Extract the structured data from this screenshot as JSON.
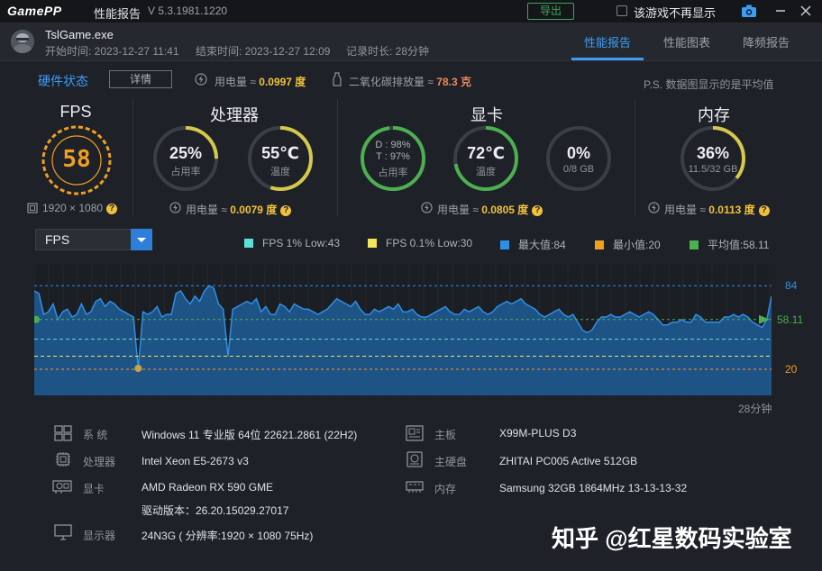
{
  "titlebar": {
    "logo": "GamePP",
    "app_name": "性能报告",
    "version": "V 5.3.1981.1220",
    "export_label": "导出",
    "dont_show_label": "该游戏不再显示"
  },
  "header": {
    "game_name": "TslGame.exe",
    "start_time": "开始时间: 2023-12-27 11:41",
    "end_time": "结束时间: 2023-12-27 12:09",
    "duration": "记录时长: 28分钟",
    "tabs": [
      {
        "label": "性能报告",
        "active": true
      },
      {
        "label": "性能图表",
        "active": false
      },
      {
        "label": "降频报告",
        "active": false
      }
    ]
  },
  "hardware": {
    "title": "硬件状态",
    "detail_label": "详情",
    "power_label": "用电量 ≈",
    "power_value": "0.0997 度",
    "co2_label": "二氧化碳排放量 ≈",
    "co2_value": "78.3 克",
    "ps_note": "P.S. 数据图显示的是平均值",
    "fps": {
      "title": "FPS",
      "value": "58",
      "resolution": "1920 × 1080"
    },
    "cpu": {
      "title": "处理器",
      "usage_value": "25%",
      "usage_label": "占用率",
      "usage_frac": 0.25,
      "temp_value": "55℃",
      "temp_label": "温度",
      "temp_frac": 0.55,
      "power_label": "用电量 ≈",
      "power_value": "0.0079 度"
    },
    "gpu": {
      "title": "显卡",
      "d_value": "D : 98%",
      "t_value": "T : 97%",
      "usage_label": "占用率",
      "usage_frac": 0.98,
      "temp_value": "72℃",
      "temp_label": "温度",
      "temp_frac": 0.72,
      "vram_value": "0%",
      "vram_label": "0/8 GB",
      "vram_frac": 0.0,
      "power_label": "用电量 ≈",
      "power_value": "0.0805 度"
    },
    "memory": {
      "title": "内存",
      "usage_value": "36%",
      "usage_label": "11.5/32 GB",
      "usage_frac": 0.36,
      "power_label": "用电量 ≈",
      "power_value": "0.0113 度"
    },
    "help_glyph": "?"
  },
  "chart_controls": {
    "selected_metric": "FPS",
    "legend": [
      {
        "label": "FPS 1% Low:43",
        "color": "#5ce0d8"
      },
      {
        "label": "FPS 0.1% Low:30",
        "color": "#f4e55a"
      },
      {
        "label": "最大值:84",
        "color": "#2e8fe6"
      },
      {
        "label": "最小值:20",
        "color": "#f0a020"
      },
      {
        "label": "平均值:58.11",
        "color": "#4caf50"
      }
    ]
  },
  "chart_data": {
    "type": "area",
    "ylim": [
      0,
      100
    ],
    "x_end_label": "28分钟",
    "reference_lines": [
      {
        "label": "84",
        "value": 84,
        "color": "#2e8fe6"
      },
      {
        "label": "58.11",
        "value": 58.11,
        "color": "#4caf50"
      },
      {
        "label": "20",
        "value": 20,
        "color": "#f0a020"
      }
    ],
    "extra_lines": [
      {
        "value": 43,
        "color": "#5ce0d8"
      },
      {
        "value": 30,
        "color": "#f4e55a"
      }
    ],
    "values": [
      80,
      78,
      62,
      64,
      70,
      58,
      64,
      66,
      60,
      62,
      70,
      62,
      64,
      72,
      74,
      68,
      72,
      70,
      66,
      64,
      62,
      60,
      20,
      64,
      62,
      64,
      68,
      60,
      62,
      62,
      78,
      80,
      74,
      70,
      76,
      72,
      80,
      84,
      82,
      70,
      66,
      30,
      66,
      68,
      70,
      72,
      70,
      74,
      64,
      68,
      62,
      62,
      70,
      68,
      64,
      70,
      68,
      66,
      66,
      64,
      62,
      64,
      66,
      70,
      74,
      72,
      70,
      68,
      72,
      66,
      62,
      62,
      66,
      64,
      66,
      68,
      66,
      70,
      64,
      64,
      66,
      62,
      60,
      60,
      62,
      64,
      66,
      68,
      64,
      62,
      62,
      66,
      64,
      66,
      68,
      64,
      62,
      64,
      68,
      70,
      72,
      70,
      72,
      74,
      70,
      68,
      66,
      62,
      60,
      62,
      64,
      66,
      62,
      60,
      62,
      56,
      50,
      48,
      50,
      56,
      60,
      60,
      62,
      60,
      60,
      62,
      64,
      62,
      60,
      62,
      64,
      62,
      58,
      54,
      54,
      56,
      56,
      58,
      56,
      56,
      62,
      60,
      56,
      56,
      56,
      56,
      60,
      60,
      62,
      60,
      62,
      60,
      56,
      54,
      52,
      58,
      76
    ]
  },
  "system": {
    "rows": [
      {
        "icon": "windows-icon",
        "key": "系 统",
        "value": "Windows 11 专业版 64位 22621.2861 (22H2)"
      },
      {
        "icon": "cpu-icon",
        "key": "处理器",
        "value": "Intel Xeon E5-2673 v3"
      },
      {
        "icon": "gpu-icon",
        "key": "显卡",
        "value": "AMD Radeon RX 590 GME",
        "extra": "驱动版本：26.20.15029.27017"
      },
      {
        "icon": "monitor-icon",
        "key": "显示器",
        "value": "24N3G ( 分辨率:1920 × 1080 75Hz)"
      }
    ],
    "rows_right": [
      {
        "icon": "motherboard-icon",
        "key": "主板",
        "value": "X99M-PLUS D3"
      },
      {
        "icon": "disk-icon",
        "key": "主硬盘",
        "value": "ZHITAI PC005 Active 512GB"
      },
      {
        "icon": "memory-icon",
        "key": "内存",
        "value": "Samsung 32GB 1864MHz 13-13-13-32"
      }
    ]
  },
  "watermark": "知乎 @红星数码实验室"
}
